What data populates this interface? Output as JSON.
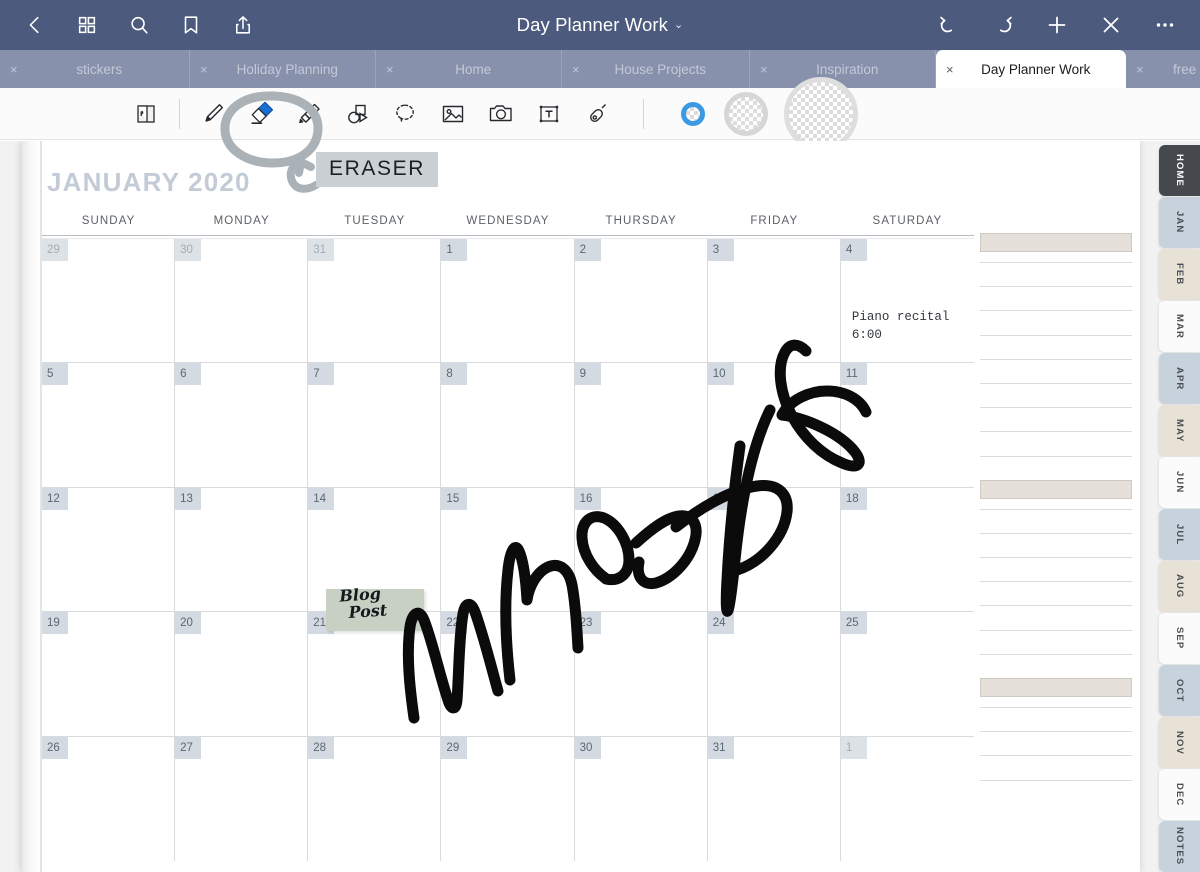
{
  "header": {
    "title": "Day Planner Work",
    "caret": "⌄",
    "left_icons": [
      {
        "name": "back-icon",
        "label": "Back"
      },
      {
        "name": "grid-icon",
        "label": "Library"
      },
      {
        "name": "search-icon",
        "label": "Search"
      },
      {
        "name": "bookmark-icon",
        "label": "Bookmark"
      },
      {
        "name": "share-icon",
        "label": "Share"
      }
    ],
    "right_icons": [
      {
        "name": "undo-icon",
        "label": "Undo"
      },
      {
        "name": "redo-icon",
        "label": "Redo"
      },
      {
        "name": "add-icon",
        "label": "Add page"
      },
      {
        "name": "close-icon",
        "label": "Close"
      },
      {
        "name": "more-icon",
        "label": "More"
      }
    ]
  },
  "tabs": [
    {
      "label": "stickers",
      "close": "×",
      "active": false
    },
    {
      "label": "Holiday Planning",
      "close": "×",
      "active": false
    },
    {
      "label": "Home",
      "close": "×",
      "active": false
    },
    {
      "label": "House Projects",
      "close": "×",
      "active": false
    },
    {
      "label": "Inspiration",
      "close": "×",
      "active": false
    },
    {
      "label": "Day Planner Work",
      "close": "×",
      "active": true
    },
    {
      "label": "free p",
      "close": "×",
      "active": false
    }
  ],
  "toolbar": {
    "items": [
      {
        "name": "page-view-icon",
        "label": "Page view",
        "selected": false
      },
      {
        "name": "pen-icon",
        "label": "Pen",
        "selected": false
      },
      {
        "name": "eraser-icon",
        "label": "Eraser",
        "selected": true
      },
      {
        "name": "highlighter-icon",
        "label": "Highlighter",
        "selected": false
      },
      {
        "name": "shapes-icon",
        "label": "Shapes",
        "selected": false
      },
      {
        "name": "lasso-icon",
        "label": "Lasso select",
        "selected": false
      },
      {
        "name": "image-icon",
        "label": "Insert image",
        "selected": false
      },
      {
        "name": "camera-icon",
        "label": "Camera",
        "selected": false
      },
      {
        "name": "text-box-icon",
        "label": "Text box",
        "selected": false
      },
      {
        "name": "eyedropper-icon",
        "label": "Eyedropper",
        "selected": false
      }
    ],
    "swatches": [
      {
        "name": "size-small-swatch",
        "label": "Small",
        "selected": true,
        "accent": "#3b9ae1"
      },
      {
        "name": "size-medium-swatch",
        "label": "Medium",
        "selected": false,
        "accent": "#d6d6d6"
      },
      {
        "name": "size-large-swatch",
        "label": "Large",
        "selected": false,
        "accent": "#dedede"
      }
    ]
  },
  "annotations": {
    "eraser_callout": "ERASER",
    "handwriting": "Whoops"
  },
  "planner": {
    "month_title": "JANUARY 2020",
    "day_headers": [
      "SUNDAY",
      "MONDAY",
      "TUESDAY",
      "WEDNESDAY",
      "THURSDAY",
      "FRIDAY",
      "SATURDAY"
    ],
    "weeks": [
      [
        {
          "day": "29",
          "muted": true,
          "event": ""
        },
        {
          "day": "30",
          "muted": true,
          "event": ""
        },
        {
          "day": "31",
          "muted": true,
          "event": ""
        },
        {
          "day": "1",
          "muted": false,
          "event": ""
        },
        {
          "day": "2",
          "muted": false,
          "event": ""
        },
        {
          "day": "3",
          "muted": false,
          "event": ""
        },
        {
          "day": "4",
          "muted": false,
          "event": "Piano recital\n6:00"
        }
      ],
      [
        {
          "day": "5",
          "muted": false,
          "event": ""
        },
        {
          "day": "6",
          "muted": false,
          "event": ""
        },
        {
          "day": "7",
          "muted": false,
          "event": ""
        },
        {
          "day": "8",
          "muted": false,
          "event": ""
        },
        {
          "day": "9",
          "muted": false,
          "event": ""
        },
        {
          "day": "10",
          "muted": false,
          "event": ""
        },
        {
          "day": "11",
          "muted": false,
          "event": ""
        }
      ],
      [
        {
          "day": "12",
          "muted": false,
          "event": ""
        },
        {
          "day": "13",
          "muted": false,
          "event": ""
        },
        {
          "day": "14",
          "muted": false,
          "event": ""
        },
        {
          "day": "15",
          "muted": false,
          "event": ""
        },
        {
          "day": "16",
          "muted": false,
          "event": ""
        },
        {
          "day": "17",
          "muted": false,
          "event": ""
        },
        {
          "day": "18",
          "muted": false,
          "event": ""
        }
      ],
      [
        {
          "day": "19",
          "muted": false,
          "event": ""
        },
        {
          "day": "20",
          "muted": false,
          "event": ""
        },
        {
          "day": "21",
          "muted": false,
          "event": ""
        },
        {
          "day": "22",
          "muted": false,
          "event": ""
        },
        {
          "day": "23",
          "muted": false,
          "event": ""
        },
        {
          "day": "24",
          "muted": false,
          "event": ""
        },
        {
          "day": "25",
          "muted": false,
          "event": ""
        }
      ],
      [
        {
          "day": "26",
          "muted": false,
          "event": ""
        },
        {
          "day": "27",
          "muted": false,
          "event": ""
        },
        {
          "day": "28",
          "muted": false,
          "event": ""
        },
        {
          "day": "29",
          "muted": false,
          "event": ""
        },
        {
          "day": "30",
          "muted": false,
          "event": ""
        },
        {
          "day": "31",
          "muted": false,
          "event": ""
        },
        {
          "day": "1",
          "muted": true,
          "event": ""
        }
      ]
    ],
    "sticker": {
      "line1": "Blog",
      "line2": "Post"
    },
    "side_tabs": [
      {
        "label": "HOME",
        "style": "dark"
      },
      {
        "label": "JAN",
        "style": "blue"
      },
      {
        "label": "FEB",
        "style": "beige"
      },
      {
        "label": "MAR",
        "style": "white"
      },
      {
        "label": "APR",
        "style": "blue"
      },
      {
        "label": "MAY",
        "style": "beige"
      },
      {
        "label": "JUN",
        "style": "white"
      },
      {
        "label": "JUL",
        "style": "blue"
      },
      {
        "label": "AUG",
        "style": "beige"
      },
      {
        "label": "SEP",
        "style": "white"
      },
      {
        "label": "OCT",
        "style": "blue"
      },
      {
        "label": "NOV",
        "style": "beige"
      },
      {
        "label": "DEC",
        "style": "white"
      },
      {
        "label": "NOTES",
        "style": "blue"
      }
    ]
  },
  "colors": {
    "header_bg": "#4b5a7d",
    "tabbar_bg": "#8791ab",
    "accent": "#3b9ae1",
    "eraser_blue": "#1a6fd4",
    "month_title": "#c3ccd6",
    "daynum_bg": "#d3dae1",
    "sticker_bg": "#c8cfc3"
  }
}
